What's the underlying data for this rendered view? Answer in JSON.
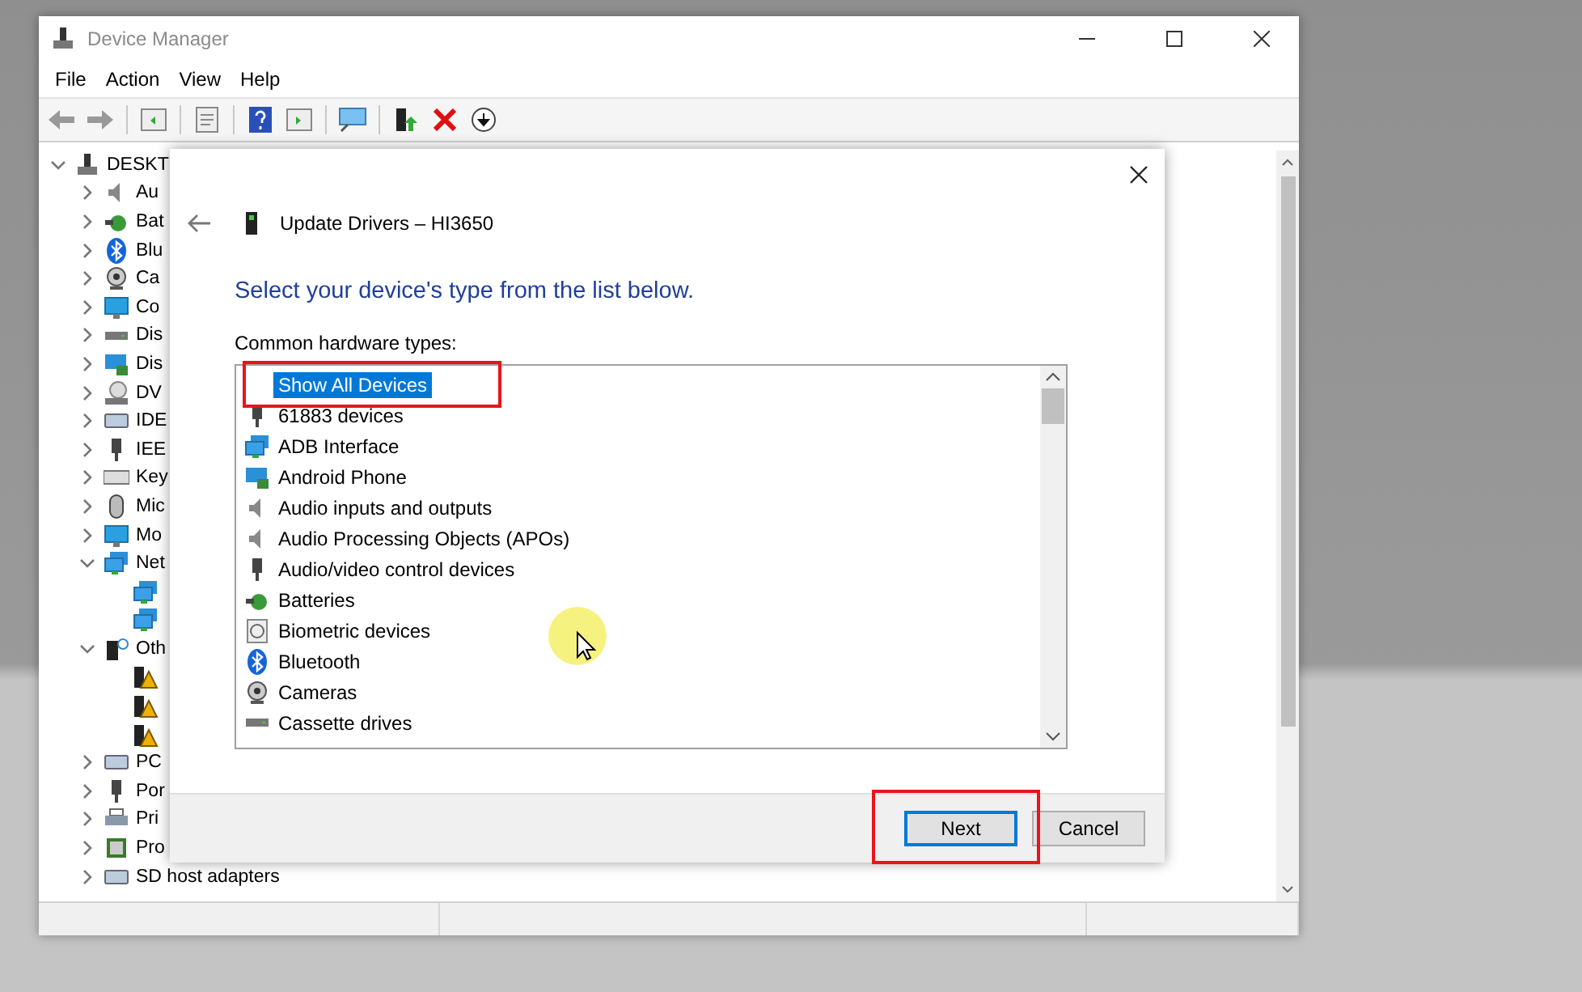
{
  "window": {
    "title": "Device Manager"
  },
  "menu": [
    "File",
    "Action",
    "View",
    "Help"
  ],
  "tree": {
    "label": "DESKT",
    "kind": "computer",
    "expanded": true,
    "children": [
      {
        "label": "Au",
        "kind": "speaker",
        "expanded": false
      },
      {
        "label": "Bat",
        "kind": "battery",
        "expanded": false
      },
      {
        "label": "Blu",
        "kind": "bluetooth",
        "expanded": false
      },
      {
        "label": "Ca",
        "kind": "camera",
        "expanded": false
      },
      {
        "label": "Co",
        "kind": "monitor",
        "expanded": false
      },
      {
        "label": "Dis",
        "kind": "disk",
        "expanded": false
      },
      {
        "label": "Dis",
        "kind": "display",
        "expanded": false
      },
      {
        "label": "DV",
        "kind": "disc",
        "expanded": false
      },
      {
        "label": "IDE",
        "kind": "card",
        "expanded": false
      },
      {
        "label": "IEE",
        "kind": "plug",
        "expanded": false
      },
      {
        "label": "Key",
        "kind": "keyboard",
        "expanded": false
      },
      {
        "label": "Mic",
        "kind": "mouse",
        "expanded": false
      },
      {
        "label": "Mo",
        "kind": "monitor",
        "expanded": false
      },
      {
        "label": "Net",
        "kind": "network",
        "expanded": true,
        "children": [
          {
            "kind": "network"
          },
          {
            "kind": "network"
          }
        ]
      },
      {
        "label": "Oth",
        "kind": "unknown",
        "expanded": true,
        "children": [
          {
            "kind": "warning"
          },
          {
            "kind": "warning"
          },
          {
            "kind": "warning"
          }
        ]
      },
      {
        "label": "PC",
        "kind": "card",
        "expanded": false
      },
      {
        "label": "Por",
        "kind": "plug",
        "expanded": false
      },
      {
        "label": "Pri",
        "kind": "printer",
        "expanded": false
      },
      {
        "label": "Pro",
        "kind": "chip",
        "expanded": false
      },
      {
        "label": "SD host adapters",
        "kind": "card",
        "expanded": false
      }
    ]
  },
  "dialog": {
    "title": "Update Drivers – HI3650",
    "heading": "Select your device's type from the list below.",
    "list_label": "Common hardware types:",
    "items": [
      {
        "label": "Show All Devices",
        "kind": "none",
        "selected": true,
        "highlighted": true
      },
      {
        "label": "61883 devices",
        "kind": "plug",
        "selected": false,
        "highlighted": false
      },
      {
        "label": "ADB Interface",
        "kind": "network",
        "selected": false,
        "highlighted": false
      },
      {
        "label": "Android Phone",
        "kind": "display",
        "selected": false,
        "highlighted": false
      },
      {
        "label": "Audio inputs and outputs",
        "kind": "speaker",
        "selected": false,
        "highlighted": false
      },
      {
        "label": "Audio Processing Objects (APOs)",
        "kind": "speaker",
        "selected": false,
        "highlighted": false
      },
      {
        "label": "Audio/video control devices",
        "kind": "plug",
        "selected": false,
        "highlighted": false
      },
      {
        "label": "Batteries",
        "kind": "battery",
        "selected": false,
        "highlighted": false
      },
      {
        "label": "Biometric devices",
        "kind": "fingerprint",
        "selected": false,
        "highlighted": false
      },
      {
        "label": "Bluetooth",
        "kind": "bluetooth",
        "selected": false,
        "highlighted": false
      },
      {
        "label": "Cameras",
        "kind": "camera",
        "selected": false,
        "highlighted": false
      },
      {
        "label": "Cassette drives",
        "kind": "disk",
        "selected": false,
        "highlighted": false
      }
    ],
    "buttons": [
      {
        "label": "Next",
        "default": true,
        "highlighted": true
      },
      {
        "label": "Cancel",
        "default": false,
        "highlighted": false
      }
    ]
  }
}
